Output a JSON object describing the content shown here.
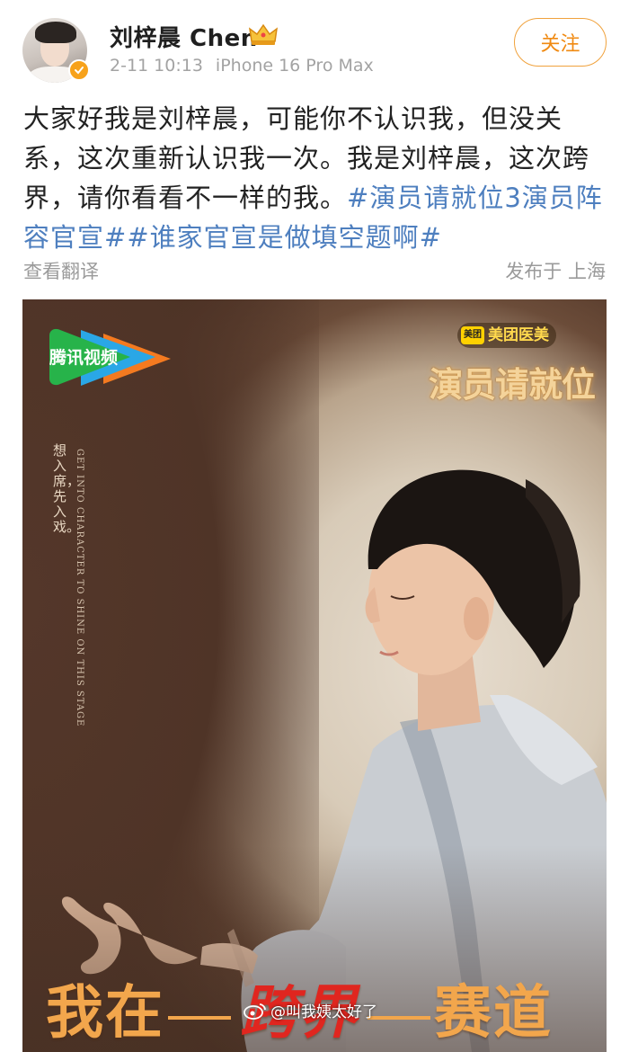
{
  "header": {
    "username": "刘梓晨 Chen",
    "timestamp": "2-11 10:13",
    "device": "iPhone 16 Pro Max",
    "follow_label": "关注",
    "avatar_icon": "user-avatar",
    "badge_icon": "verified-badge-icon",
    "crown_icon": "crown-icon"
  },
  "post": {
    "text_plain": "大家好我是刘梓晨，可能你不认识我，但没关系，这次重新认识我一次。我是刘梓晨，这次跨界，请你看看不一样的我。",
    "hashtag_1": "#演员请就位3演员阵容官宣#",
    "hashtag_2": "#谁家官宣是做填空题啊#",
    "translate_label": "查看翻译",
    "location_label": "发布于 上海"
  },
  "poster": {
    "platform_logo": "腾讯视频",
    "sponsor": "美团医美",
    "sponsor_mark": "美团",
    "show_title": "演员请就位",
    "tagline_cn": "想入席，先入戏。",
    "tagline_en": "GET INTO CHARACTER    TO SHINE ON THIS STAGE",
    "slogan_left": "我在",
    "slogan_mid": "跨界",
    "slogan_right": "赛道",
    "watermark": "@叫我姨太好了"
  },
  "colors": {
    "hashtag": "#4e7fbf",
    "follow": "#f08a12",
    "verify_badge": "#f7a21b",
    "meta_text": "#a3a3a3"
  }
}
